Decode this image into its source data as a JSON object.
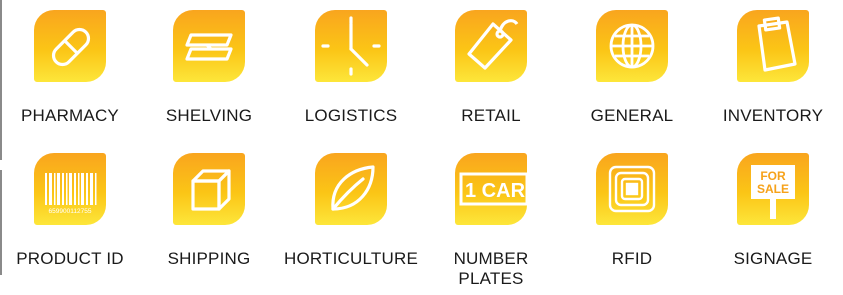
{
  "tiles_row1": [
    {
      "label": "PHARMACY",
      "icon": "pill-icon"
    },
    {
      "label": "SHELVING",
      "icon": "shelving-icon"
    },
    {
      "label": "LOGISTICS",
      "icon": "clock-icon"
    },
    {
      "label": "RETAIL",
      "icon": "price-tag-icon"
    },
    {
      "label": "GENERAL",
      "icon": "globe-icon"
    },
    {
      "label": "INVENTORY",
      "icon": "clipboard-icon"
    }
  ],
  "tiles_row2": [
    {
      "label": "PRODUCT ID",
      "icon": "barcode-icon",
      "barcode_number": "659900112755"
    },
    {
      "label": "SHIPPING",
      "icon": "box-icon"
    },
    {
      "label": "HORTICULTURE",
      "icon": "leaf-icon"
    },
    {
      "label": "NUMBER\nPLATES",
      "icon": "number-plate-icon",
      "plate_text": "1 CAR"
    },
    {
      "label": "RFID",
      "icon": "rfid-icon"
    },
    {
      "label": "SIGNAGE",
      "icon": "for-sale-sign-icon",
      "sign_text_line1": "FOR",
      "sign_text_line2": "SALE"
    }
  ],
  "colors": {
    "gradient_top": "#f9a51e",
    "gradient_bottom": "#fde63a",
    "label": "#1a1a1a",
    "rule": "#8a8a8a"
  }
}
